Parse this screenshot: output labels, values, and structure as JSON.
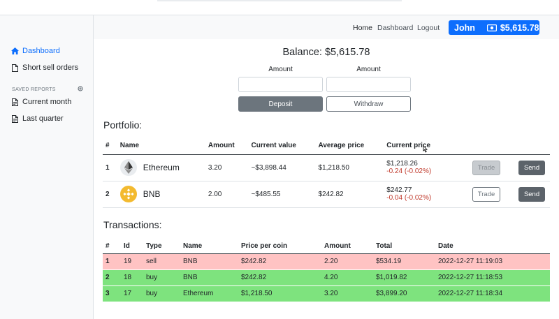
{
  "sidebar": {
    "items": [
      {
        "label": "Dashboard",
        "icon": "home-icon"
      },
      {
        "label": "Short sell orders",
        "icon": "file-icon"
      }
    ],
    "saved_heading": "SAVED REPORTS",
    "saved_items": [
      {
        "label": "Current month",
        "icon": "file-text-icon"
      },
      {
        "label": "Last quarter",
        "icon": "file-text-icon"
      }
    ]
  },
  "nav": {
    "home": "Home",
    "dashboard": "Dashboard",
    "logout": "Logout",
    "user_name": "John",
    "user_balance": "$5,615.78"
  },
  "balance": {
    "text": "Balance: $5,615.78",
    "amount_label_1": "Amount",
    "amount_label_2": "Amount",
    "deposit": "Deposit",
    "withdraw": "Withdraw"
  },
  "portfolio": {
    "title": "Portfolio:",
    "headers": [
      "#",
      "Name",
      "Amount",
      "Current value",
      "Average price",
      "Current price"
    ],
    "rows": [
      {
        "idx": "1",
        "name": "Ethereum",
        "amount": "3.20",
        "value": "~$3,898.44",
        "avg": "$1,218.50",
        "price": "$1,218.26",
        "change": "-0.24 (-0.02%)",
        "trade": "Trade",
        "send": "Send"
      },
      {
        "idx": "2",
        "name": "BNB",
        "amount": "2.00",
        "value": "~$485.55",
        "avg": "$242.82",
        "price": "$242.77",
        "change": "-0.04 (-0.02%)",
        "trade": "Trade",
        "send": "Send"
      }
    ]
  },
  "transactions": {
    "title": "Transactions:",
    "headers": [
      "#",
      "Id",
      "Type",
      "Name",
      "Price per coin",
      "Amount",
      "Total",
      "Date"
    ],
    "rows": [
      {
        "idx": "1",
        "id": "19",
        "type": "sell",
        "name": "BNB",
        "ppc": "$242.82",
        "amount": "2.20",
        "total": "$534.19",
        "date": "2022-12-27 11:19:03"
      },
      {
        "idx": "2",
        "id": "18",
        "type": "buy",
        "name": "BNB",
        "ppc": "$242.82",
        "amount": "4.20",
        "total": "$1,019.82",
        "date": "2022-12-27 11:18:53"
      },
      {
        "idx": "3",
        "id": "17",
        "type": "buy",
        "name": "Ethereum",
        "ppc": "$1,218.50",
        "amount": "3.20",
        "total": "$3,899.20",
        "date": "2022-12-27 11:18:34"
      }
    ]
  },
  "colors": {
    "accent": "#0d6efd",
    "sell_row": "#ffc3c3",
    "buy_row": "#7ee37e",
    "negative": "#c0392b"
  }
}
